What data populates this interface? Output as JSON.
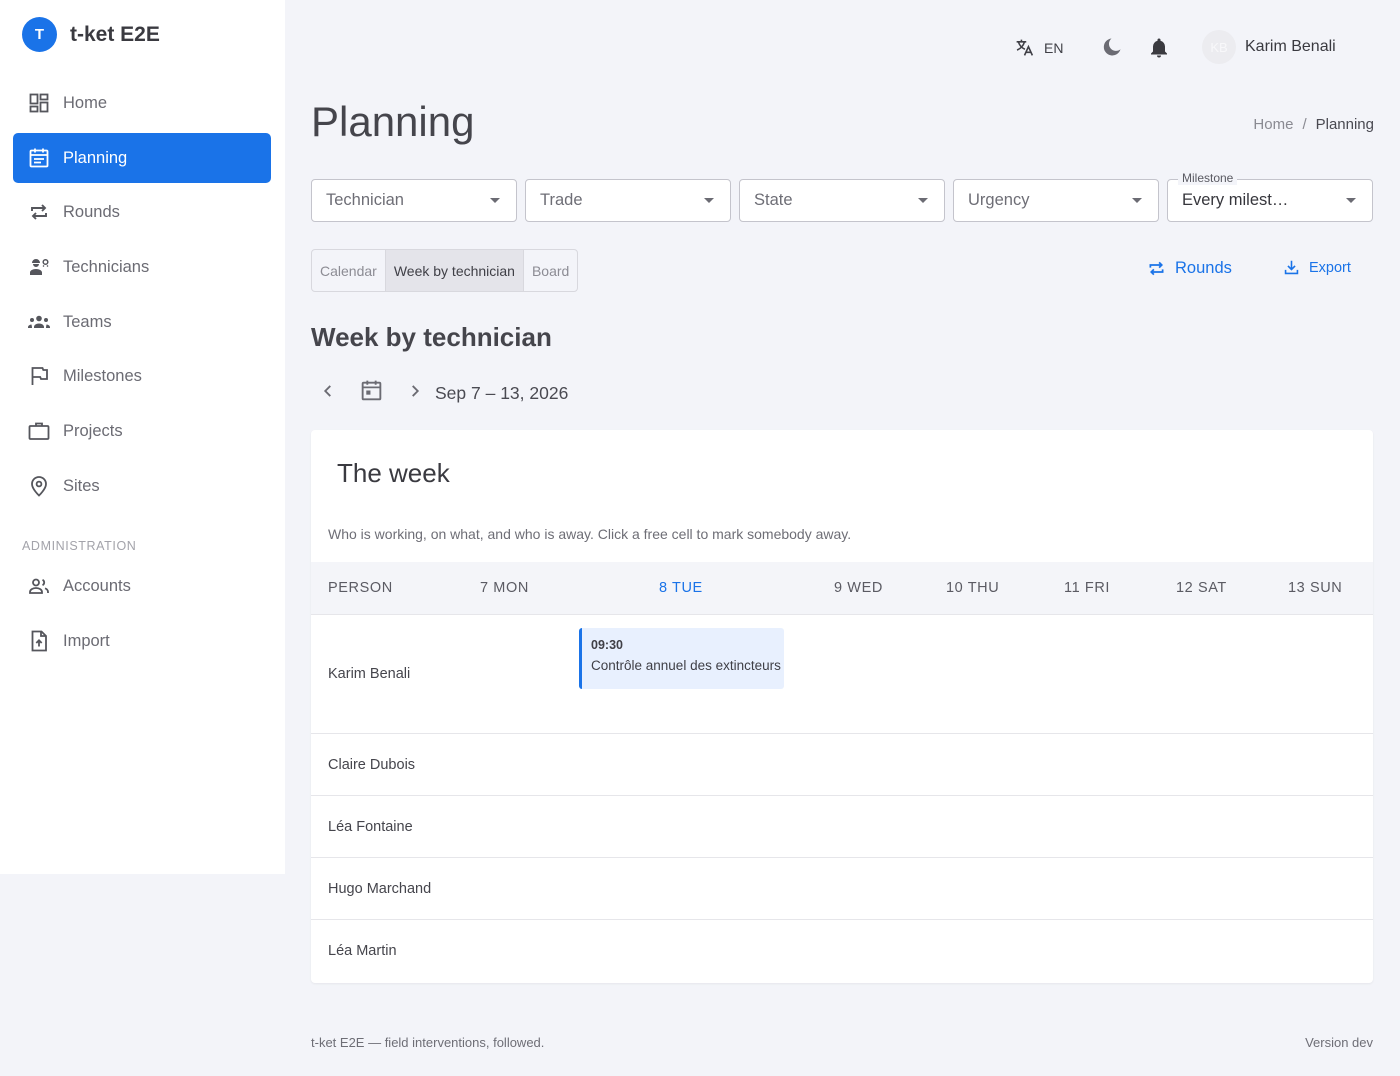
{
  "app": {
    "logo_letter": "T",
    "name": "t-ket E2E"
  },
  "sidebar": {
    "items": [
      {
        "label": "Home",
        "icon": "dashboard-icon"
      },
      {
        "label": "Planning",
        "icon": "calendar-icon",
        "active": true
      },
      {
        "label": "Rounds",
        "icon": "repeat-icon"
      },
      {
        "label": "Technicians",
        "icon": "engineer-icon"
      },
      {
        "label": "Teams",
        "icon": "groups-icon"
      },
      {
        "label": "Milestones",
        "icon": "flag-icon"
      },
      {
        "label": "Projects",
        "icon": "briefcase-icon"
      },
      {
        "label": "Sites",
        "icon": "location-pin-icon"
      }
    ],
    "admin_label": "ADMINISTRATION",
    "admin_items": [
      {
        "label": "Accounts",
        "icon": "people-icon"
      },
      {
        "label": "Import",
        "icon": "file-upload-icon"
      }
    ]
  },
  "topbar": {
    "language": "EN",
    "user": {
      "initials": "KB",
      "name": "Karim Benali"
    }
  },
  "page": {
    "title": "Planning",
    "breadcrumb": {
      "home": "Home",
      "separator": "/",
      "current": "Planning"
    }
  },
  "filters": {
    "technician": "Technician",
    "trade": "Trade",
    "state": "State",
    "urgency": "Urgency",
    "milestone_label": "Milestone",
    "milestone_value": "Every milest…"
  },
  "views": {
    "calendar": "Calendar",
    "week": "Week by technician",
    "board": "Board",
    "active": "Week by technician"
  },
  "actions": {
    "rounds": "Rounds",
    "export": "Export"
  },
  "section": {
    "title": "Week by technician",
    "range": "Sep 7 – 13, 2026"
  },
  "week_card": {
    "title": "The week",
    "description": "Who is working, on what, and who is away. Click a free cell to mark somebody away.",
    "columns": [
      "PERSON",
      "7 MON",
      "8 TUE",
      "9 WED",
      "10 THU",
      "11 FRI",
      "12 SAT",
      "13 SUN"
    ],
    "today_column": "8 TUE",
    "rows": [
      "Karim Benali",
      "Claire Dubois",
      "Léa Fontaine",
      "Hugo Marchand",
      "Léa Martin"
    ],
    "event": {
      "time": "09:30",
      "title": "Contrôle annuel des extincteurs",
      "technician": "Karim Benali",
      "day": "8 TUE"
    }
  },
  "footer": {
    "left": "t-ket E2E — field interventions, followed.",
    "right": "Version dev"
  },
  "colors": {
    "accent": "#1a73e8",
    "background": "#f3f4f9",
    "event_bg": "#e8f0fe"
  }
}
